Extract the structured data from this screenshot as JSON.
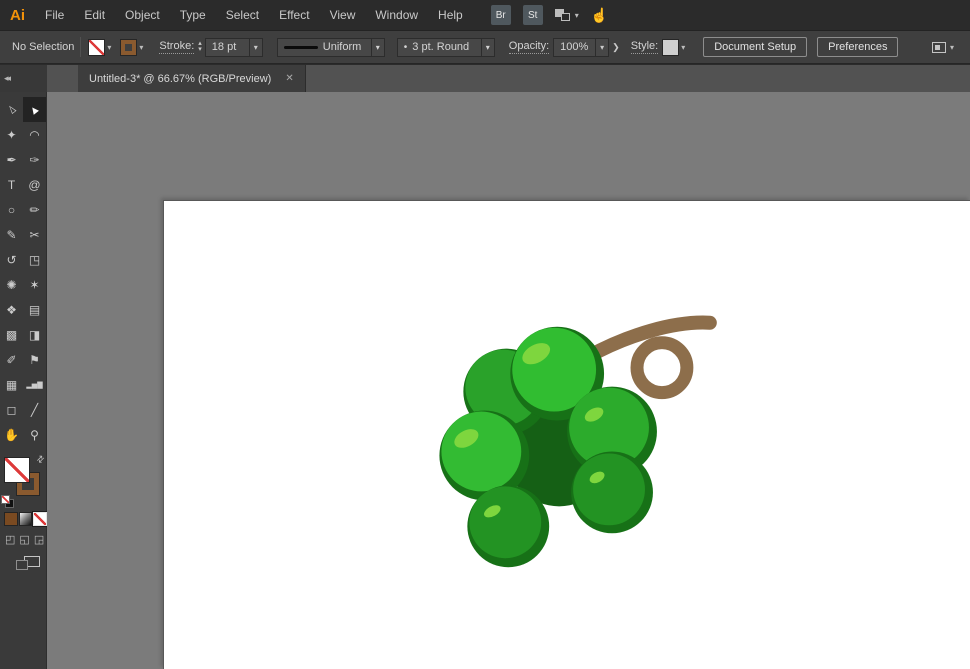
{
  "menubar": {
    "logo": "Ai",
    "items": [
      "File",
      "Edit",
      "Object",
      "Type",
      "Select",
      "Effect",
      "View",
      "Window",
      "Help"
    ],
    "badges": [
      "Br",
      "St"
    ]
  },
  "control_bar": {
    "selection_status": "No Selection",
    "stroke_label": "Stroke:",
    "stroke_value": "18 pt",
    "width_profile": "Uniform",
    "brush_name": "3 pt. Round",
    "opacity_label": "Opacity:",
    "opacity_value": "100%",
    "style_label": "Style:",
    "document_setup": "Document Setup",
    "preferences": "Preferences"
  },
  "tab": {
    "title": "Untitled-3* @ 66.67% (RGB/Preview)"
  },
  "icons": {
    "chevron_down": "▾",
    "chevron_right": "❯",
    "stepper_up": "▴",
    "stepper_down": "▾",
    "collapse_panel": "◂◂",
    "swap_fill_stroke": "⇄",
    "close_tab": "✕",
    "brush_dot": "•",
    "touch_workspace": "☝",
    "draw_normal": "◰",
    "draw_behind": "◱",
    "draw_inside": "◲"
  },
  "tools": {
    "items": [
      {
        "name": "selection",
        "glyph": "▻"
      },
      {
        "name": "direct-selection",
        "glyph": "►",
        "active": true
      },
      {
        "name": "magic-wand",
        "glyph": "✦"
      },
      {
        "name": "lasso",
        "glyph": "◠"
      },
      {
        "name": "pen",
        "glyph": "✒"
      },
      {
        "name": "curvature",
        "glyph": "✑"
      },
      {
        "name": "type",
        "glyph": "T"
      },
      {
        "name": "spiral",
        "glyph": "@"
      },
      {
        "name": "ellipse",
        "glyph": "○"
      },
      {
        "name": "paintbrush",
        "glyph": "✏"
      },
      {
        "name": "pencil",
        "glyph": "✎"
      },
      {
        "name": "scissors",
        "glyph": "✂"
      },
      {
        "name": "rotate",
        "glyph": "↺"
      },
      {
        "name": "free-transform",
        "glyph": "◳"
      },
      {
        "name": "symbol-sprayer",
        "glyph": "✺"
      },
      {
        "name": "star",
        "glyph": "✶"
      },
      {
        "name": "shape-builder",
        "glyph": "❖"
      },
      {
        "name": "perspective-grid",
        "glyph": "▤"
      },
      {
        "name": "mesh",
        "glyph": "▩"
      },
      {
        "name": "gradient",
        "glyph": "◨"
      },
      {
        "name": "eyedropper",
        "glyph": "✐"
      },
      {
        "name": "blend",
        "glyph": "⚑"
      },
      {
        "name": "artboard",
        "glyph": "▦"
      },
      {
        "name": "column-graph",
        "glyph": "▂▅▇"
      },
      {
        "name": "slice",
        "glyph": "◻"
      },
      {
        "name": "knife",
        "glyph": "╱"
      },
      {
        "name": "hand",
        "glyph": "✋"
      },
      {
        "name": "zoom",
        "glyph": "⚲"
      }
    ]
  },
  "artwork": {
    "colors": {
      "stem": "#8d6e4b",
      "core": "#156015",
      "rim": "#177117",
      "grape_back_left": "#2aa22a",
      "grape_top": "#31bd31",
      "grape_right": "#2cab2c",
      "grape_lower_right": "#239323",
      "grape_left": "#33bb33",
      "grape_bottom": "#239323",
      "highlight": "#7ed63e"
    }
  },
  "ui_colors": {
    "logo_orange": "#f2920a",
    "stroke_brown": "#8a5a2f",
    "none_red": "#dd3a3a",
    "pasteboard_gray": "#7b7b7b"
  }
}
